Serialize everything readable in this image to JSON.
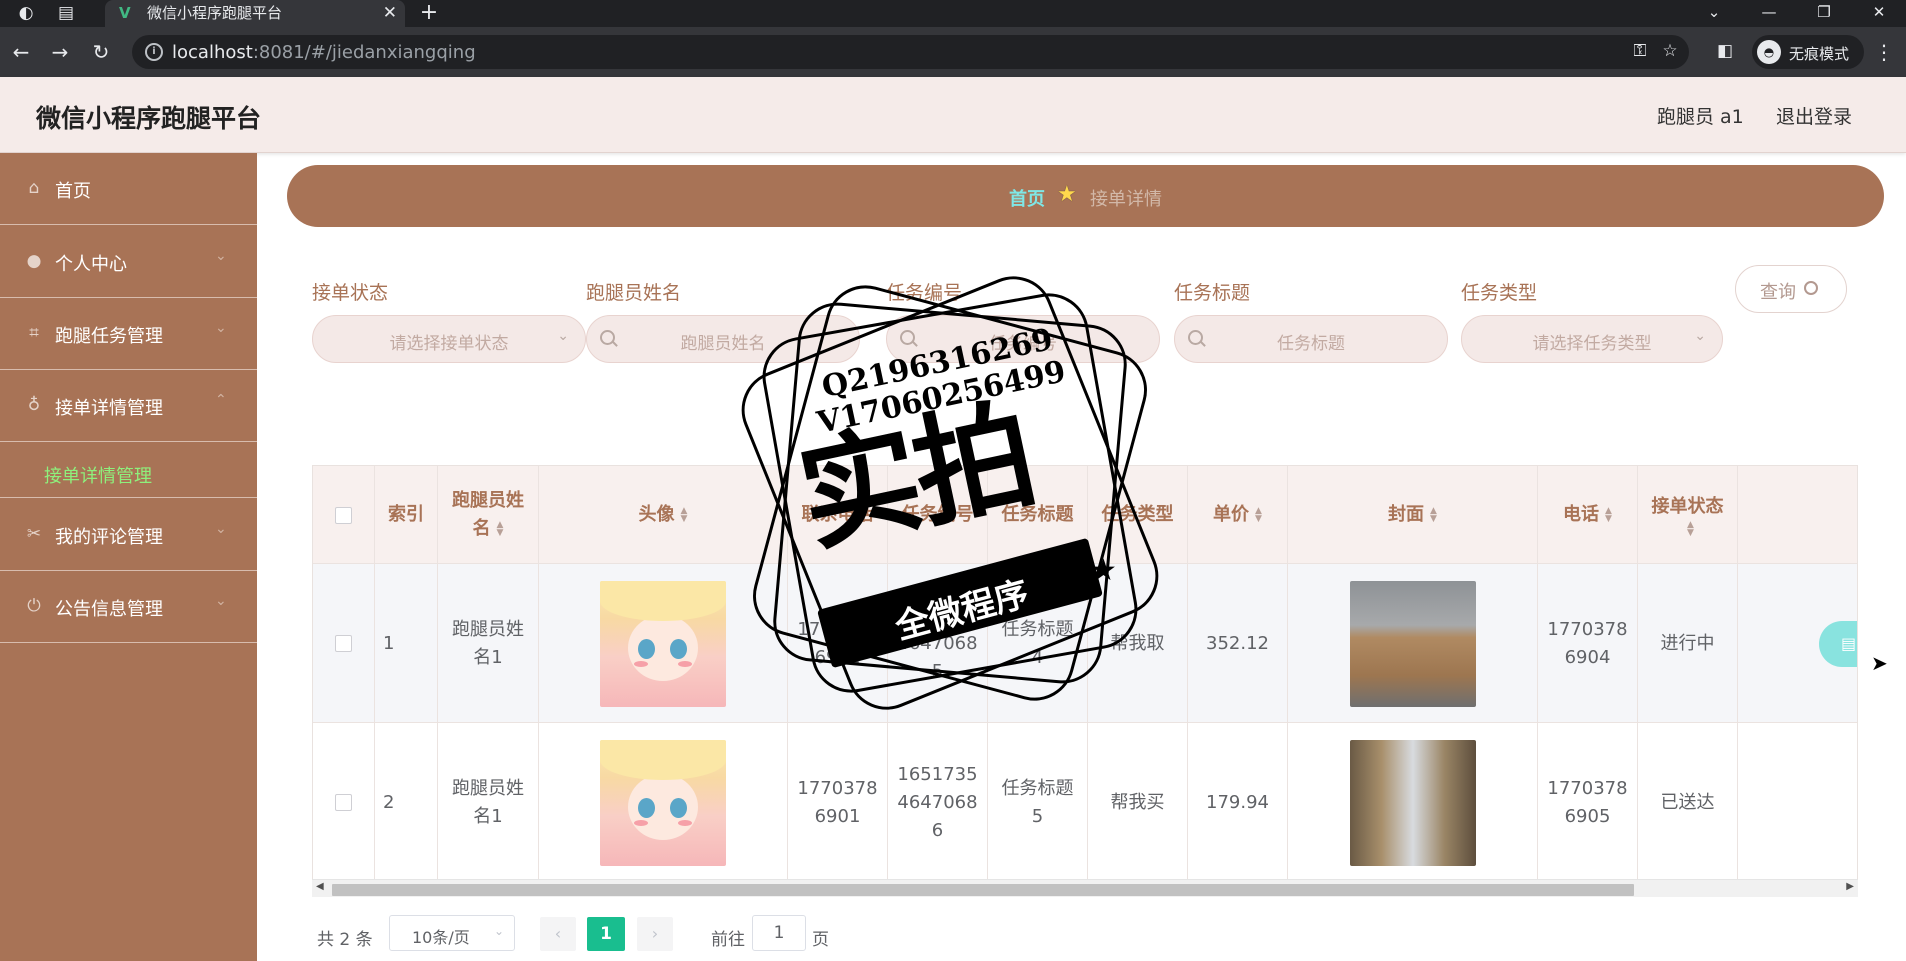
{
  "browser": {
    "tab_title": "微信小程序跑腿平台",
    "url_host": "localhost",
    "url_rest": ":8081/#/jiedanxiangqing",
    "incognito_label": "无痕模式"
  },
  "header": {
    "title": "微信小程序跑腿平台",
    "user": "跑腿员 a1",
    "logout": "退出登录"
  },
  "sidebar": {
    "items": [
      {
        "label": "首页",
        "icon": "home-icon"
      },
      {
        "label": "个人中心",
        "icon": "user-icon"
      },
      {
        "label": "跑腿任务管理",
        "icon": "crop-icon"
      },
      {
        "label": "接单详情管理",
        "icon": "mic-icon"
      },
      {
        "label": "我的评论管理",
        "icon": "ticket-icon"
      },
      {
        "label": "公告信息管理",
        "icon": "power-icon"
      }
    ],
    "submenu_label": "接单详情管理"
  },
  "breadcrumb": {
    "home": "首页",
    "current": "接单详情"
  },
  "filters": [
    {
      "label": "接单状态",
      "placeholder": "请选择接单状态",
      "kind": "select"
    },
    {
      "label": "跑腿员姓名",
      "placeholder": "跑腿员姓名",
      "kind": "search"
    },
    {
      "label": "任务编号",
      "placeholder": "任务编号",
      "kind": "search"
    },
    {
      "label": "任务标题",
      "placeholder": "任务标题",
      "kind": "search"
    },
    {
      "label": "任务类型",
      "placeholder": "请选择任务类型",
      "kind": "select"
    }
  ],
  "query_button": "查询",
  "table": {
    "columns": [
      "索引",
      "跑腿员姓名",
      "头像",
      "联系电话",
      "任务编号",
      "任务标题",
      "任务类型",
      "单价",
      "封面",
      "电话",
      "接单状态"
    ],
    "rows": [
      {
        "index": "1",
        "runner": "跑腿员姓名1",
        "contact": "17703786901",
        "task_no": "16517354647068 5",
        "task_title": "任务标题4",
        "task_type": "帮我取",
        "price": "352.12",
        "phone": "17703786904",
        "status": "进行中"
      },
      {
        "index": "2",
        "runner": "跑腿员姓名1",
        "contact": "17703786901",
        "task_no": "16517354647068 6",
        "task_title": "任务标题5",
        "task_type": "帮我买",
        "price": "179.94",
        "phone": "17703786905",
        "status": "已送达"
      }
    ],
    "row_op_label": "详"
  },
  "pagination": {
    "total": "共 2 条",
    "page_size": "10条/页",
    "current_page": "1",
    "goto_label": "前往",
    "goto_value": "1",
    "page_label": "页"
  },
  "watermark": {
    "line1": "Q2196316269",
    "line2": "V17060256499",
    "big": "实拍",
    "ribbon": "全微程序"
  }
}
